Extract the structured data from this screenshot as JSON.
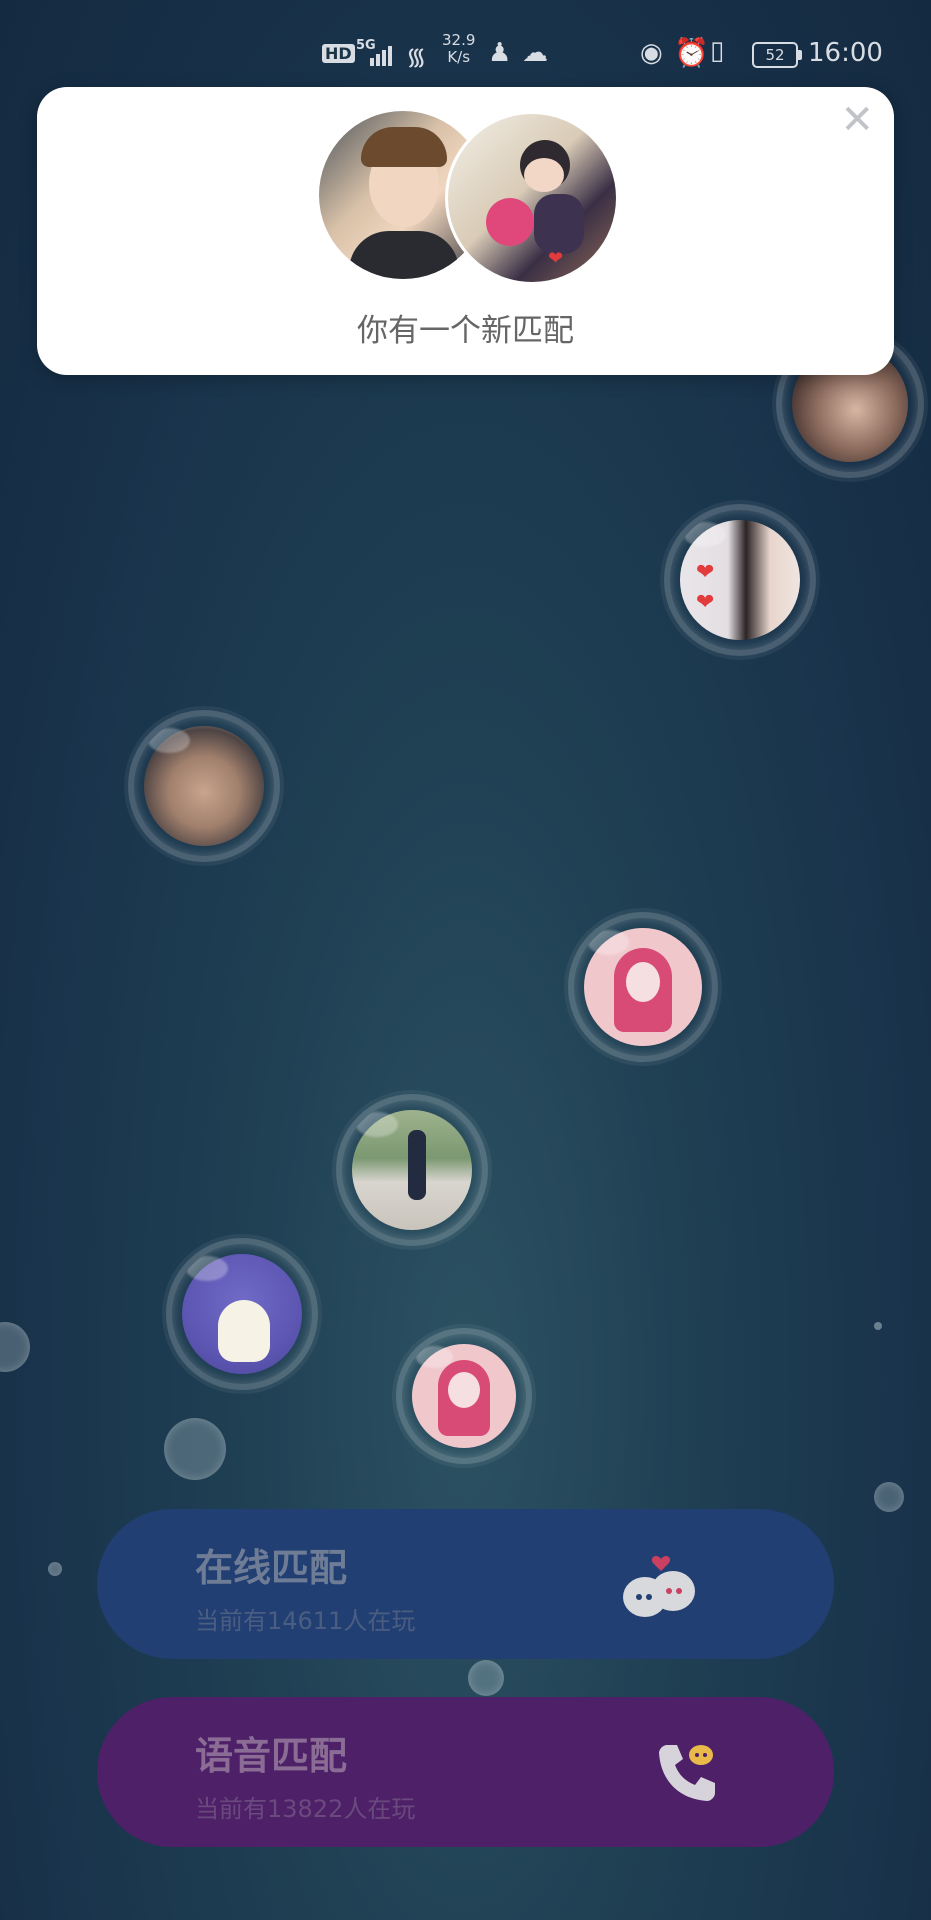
{
  "status_bar": {
    "hd": "HD",
    "network": "5G",
    "speed_value": "32.9",
    "speed_unit": "K/s",
    "battery": "52",
    "time": "16:00",
    "icons": [
      "signal-icon",
      "wifi-icon",
      "qq-icon",
      "wechat-icon",
      "eye-icon",
      "alarm-icon",
      "vibrate-icon",
      "battery-icon"
    ]
  },
  "toast": {
    "title": "你有一个新匹配",
    "close": "✕"
  },
  "buttons": {
    "online": {
      "title": "在线匹配",
      "subtitle": "当前有14611人在玩",
      "color": "#213f72"
    },
    "voice": {
      "title": "语音匹配",
      "subtitle": "当前有13822人在玩",
      "color": "#4e2068"
    }
  }
}
